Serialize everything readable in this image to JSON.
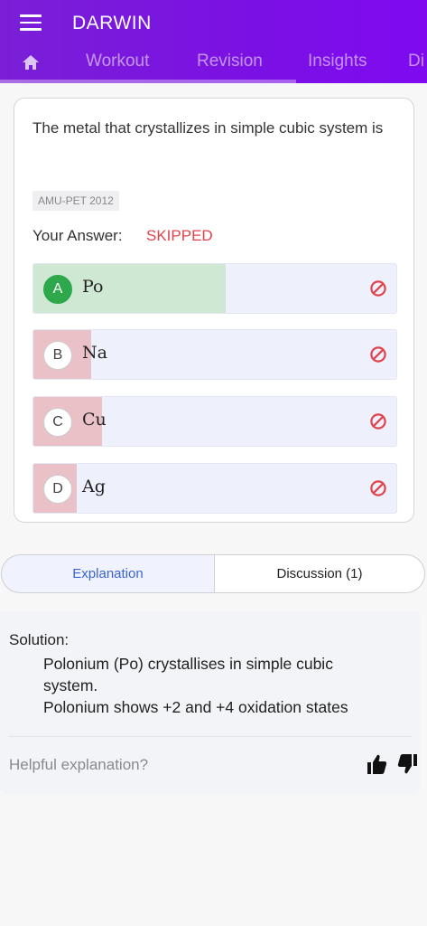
{
  "header": {
    "app_title": "DARWIN",
    "tabs": [
      {
        "icon": "home-icon"
      },
      {
        "label": "Workout"
      },
      {
        "label": "Revision"
      },
      {
        "label": "Insights"
      },
      {
        "label": "Di"
      }
    ]
  },
  "question": {
    "text": "The metal that crystallizes in simple cubic system is",
    "tag": "AMU-PET 2012",
    "your_answer_label": "Your Answer:",
    "your_answer_value": "SKIPPED"
  },
  "options": [
    {
      "letter": "A",
      "text": "Po",
      "correct": true,
      "response_fraction": 0.53
    },
    {
      "letter": "B",
      "text": "Na",
      "correct": false,
      "response_fraction": 0.16
    },
    {
      "letter": "C",
      "text": "Cu",
      "correct": false,
      "response_fraction": 0.19
    },
    {
      "letter": "D",
      "text": "Ag",
      "correct": false,
      "response_fraction": 0.12
    }
  ],
  "colors": {
    "correct_fill": "#cfe8d4",
    "incorrect_fill": "#ebc1c8",
    "accent": "#7b10e4",
    "skipped": "#e0434c"
  },
  "segments": {
    "explanation": "Explanation",
    "discussion": "Discussion (1)"
  },
  "solution": {
    "title": "Solution:",
    "line1": "Polonium (Po) crystallises in simple cubic",
    "line2": "system.",
    "line3": "Polonium shows +2 and +4 oxidation states"
  },
  "feedback": {
    "prompt": "Helpful explanation?"
  }
}
